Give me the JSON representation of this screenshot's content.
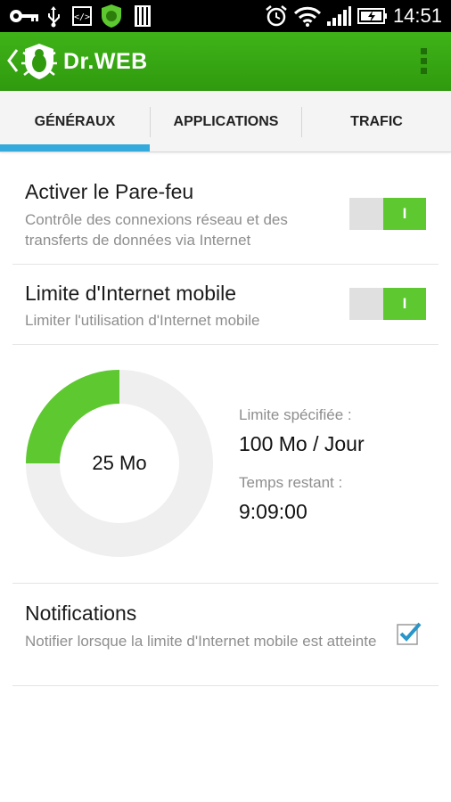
{
  "status_bar": {
    "time": "14:51",
    "icons": [
      "key-icon",
      "usb-icon",
      "developer-icon",
      "drweb-shield-icon",
      "sim-card-icon",
      "alarm-clock-icon",
      "wifi-icon",
      "signal-icon",
      "battery-charging-icon"
    ]
  },
  "app_bar": {
    "brand": "Dr.WEB",
    "back_icon": "chevron-left-icon",
    "logo_icon": "drweb-spider-logo-icon",
    "menu_icon": "overflow-menu-icon"
  },
  "tabs": [
    {
      "label": "GÉNÉRAUX",
      "active": true
    },
    {
      "label": "APPLICATIONS",
      "active": false
    },
    {
      "label": "TRAFIC",
      "active": false
    }
  ],
  "settings": {
    "firewall": {
      "title": "Activer le Pare-feu",
      "description": "Contrôle des connexions réseau et des transferts de données via Internet",
      "toggle_label": "I",
      "enabled": true
    },
    "mobile_limit": {
      "title": "Limite d'Internet mobile",
      "description": "Limiter l'utilisation d'Internet mobile",
      "toggle_label": "I",
      "enabled": true
    },
    "notifications": {
      "title": "Notifications",
      "description": "Notifier lorsque la limite d'Internet mobile est atteinte",
      "checked": true
    }
  },
  "usage": {
    "used_label": "25 Mo",
    "used_fraction": 0.25,
    "limit_label": "Limite spécifiée :",
    "limit_value": "100 Mo / Jour",
    "remaining_label": "Temps restant :",
    "remaining_value": "9:09:00"
  },
  "colors": {
    "accent_green": "#5dc830",
    "action_bar_green": "#35a512",
    "tab_indicator": "#33a9dc",
    "donut_track": "#efefef",
    "checkbox_blue": "#2a95c9"
  }
}
